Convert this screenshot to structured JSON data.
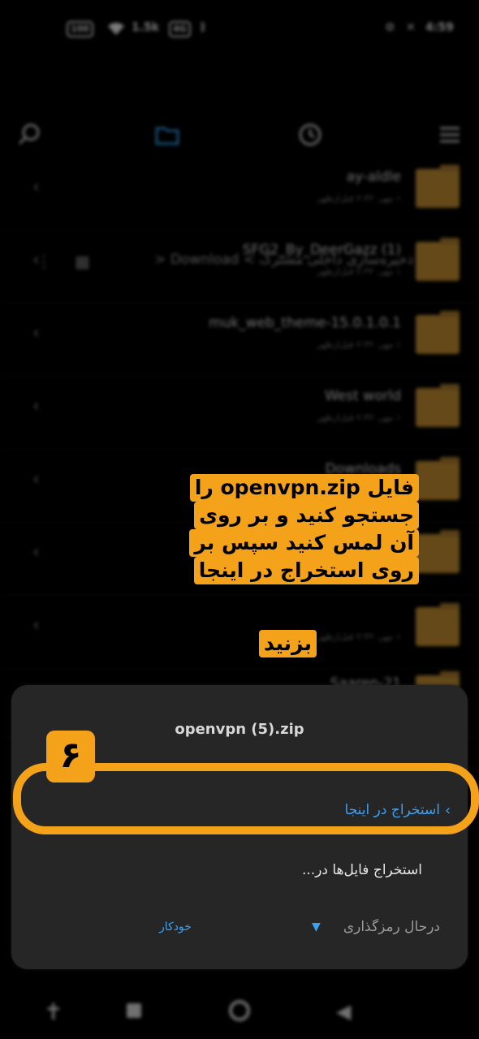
{
  "status_bar": {
    "battery_pill": "100",
    "net_pill": "4G",
    "speed": "1.5k",
    "time": "4:59"
  },
  "path": {
    "segments": "فضای ذخیره‌سازی داخلی مشترک > Download <"
  },
  "files": [
    {
      "name": "ay-aldle",
      "meta": "۱ مهر، ۲:۳۲ قبل‌ازظهر"
    },
    {
      "name": "SFG2_By_DeerGazz (1)",
      "meta": "۱ مهر، ۲:۳۲ قبل‌ازظهر"
    },
    {
      "name": "muk_web_theme-15.0.1.0.1",
      "meta": "۱ مهر، ۲:۳۲ قبل‌ازظهر"
    },
    {
      "name": "West world",
      "meta": "۱ مهر، ۲:۳۲ قبل‌ازظهر"
    },
    {
      "name": "Downloads",
      "meta": "۱ مهر، ۲:۳۲ قبل‌ازظهر"
    },
    {
      "name": "",
      "meta": ""
    },
    {
      "name": "",
      "meta": "۱ مهر، ۲:۳۲ قبل‌ازظهر"
    },
    {
      "name": "Saaren-21",
      "meta": ""
    }
  ],
  "sheet": {
    "title": "openvpn (5).zip",
    "option_extract_here": "استخراج در اینجا",
    "option_extract_to": "استخراج فایل‌ها در...",
    "encoding_label": "درحال رمزگذاری",
    "encoding_value": "خودکار"
  },
  "annotation": {
    "callout_lines": [
      "فایل openvpn.zip را",
      "جستجو کنید و بر روی",
      "آن لمس کنید سپس بر",
      "روی استخراج در اینجا",
      "بزنید"
    ],
    "step_number": "۶",
    "color": "#f5a21b"
  },
  "colors": {
    "accent": "#3ea0f0",
    "folder": "#b8862f",
    "sheet_bg": "#262626"
  }
}
